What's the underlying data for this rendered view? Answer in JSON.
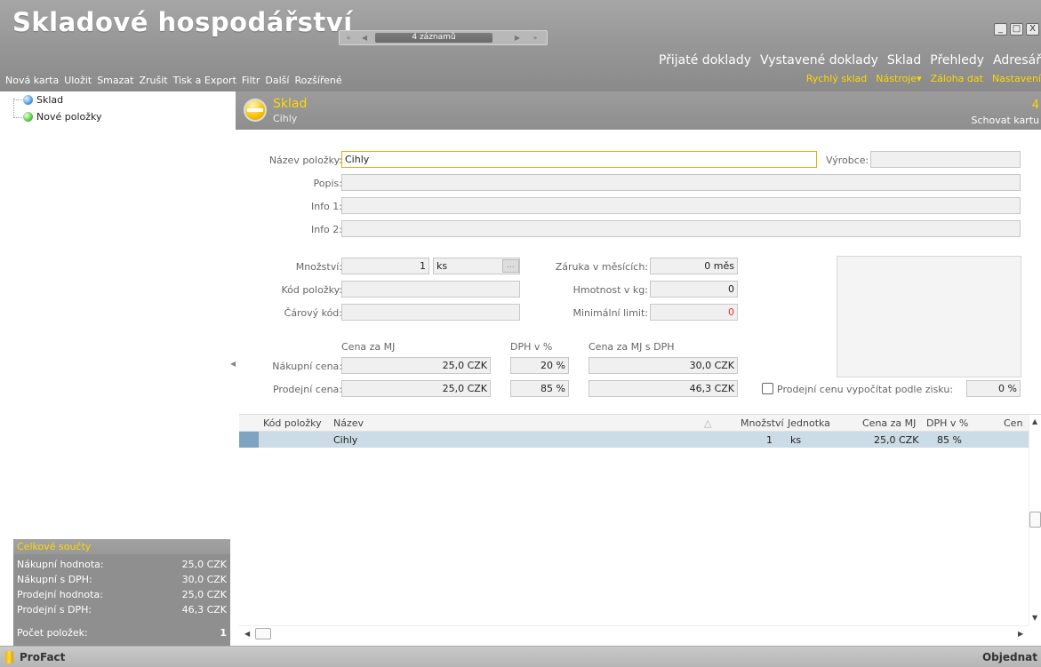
{
  "app": {
    "title": "Skladové hospodářství",
    "brand": "ProFact",
    "order_label": "Objednat"
  },
  "navigator": {
    "first": "«",
    "prev": "◀",
    "records": "4 záznamů",
    "next": "▶",
    "last": "»"
  },
  "window": {
    "minimize": "_",
    "maximize": "□",
    "close": "X"
  },
  "top_nav": [
    "Přijaté doklady",
    "Vystavené doklady",
    "Sklad",
    "Přehledy",
    "Adresář"
  ],
  "sub_nav": [
    "Rychlý sklad",
    "Nástroje▾",
    "Záloha dat",
    "Nastavení"
  ],
  "toolbar": [
    "Nová karta",
    "Uložit",
    "Smazat",
    "Zrušit",
    "Tisk a Export",
    "Filtr",
    "Další",
    "Rozšířené"
  ],
  "tree": [
    {
      "label": "Sklad",
      "icon": "blue-orb-icon"
    },
    {
      "label": "Nové položky",
      "icon": "green-orb-icon"
    }
  ],
  "totals": {
    "heading": "Celkové součty",
    "rows": [
      {
        "label": "Nákupní hodnota:",
        "value": "25,0 CZK"
      },
      {
        "label": "Nákupní s DPH:",
        "value": "30,0 CZK"
      },
      {
        "label": "Prodejní hodnota:",
        "value": "25,0 CZK"
      },
      {
        "label": "Prodejní s DPH:",
        "value": "46,3 CZK"
      },
      {
        "label": "Počet položek:",
        "value": "1"
      }
    ]
  },
  "card": {
    "title": "Sklad",
    "subtitle": "Cihly",
    "count": "4",
    "hide_label": "Schovat kartu"
  },
  "form": {
    "name_label": "Název položky:",
    "name_value": "Cihly",
    "maker_label": "Výrobce:",
    "maker_value": "",
    "desc_label": "Popis:",
    "desc_value": "",
    "info1_label": "Info 1:",
    "info1_value": "",
    "info2_label": "Info 2:",
    "info2_value": "",
    "qty_label": "Množství:",
    "qty_value": "1",
    "unit_value": "ks",
    "dots": "...",
    "code_label": "Kód položky:",
    "code_value": "",
    "barcode_label": "Čárový kód:",
    "barcode_value": "",
    "warranty_label": "Záruka v měsících:",
    "warranty_value": "0 měs",
    "weight_label": "Hmotnost v kg:",
    "weight_value": "0",
    "minlimit_label": "Minimální limit:",
    "minlimit_value": "0",
    "col_price": "Cena za MJ",
    "col_vat": "DPH v %",
    "col_price_vat": "Cena za MJ s DPH",
    "buy_label": "Nákupní cena:",
    "buy_price": "25,0 CZK",
    "buy_vat": "20 %",
    "buy_price_vat": "30,0 CZK",
    "sell_label": "Prodejní cena:",
    "sell_price": "25,0 CZK",
    "sell_vat": "85 %",
    "sell_price_vat": "46,3 CZK",
    "profit_label": "Prodejní cenu vypočítat podle zisku:",
    "profit_value": "0 %"
  },
  "grid": {
    "columns": [
      "Kód položky",
      "Název",
      "Množství",
      "Jednotka",
      "Cena za MJ",
      "DPH v %",
      "Cen"
    ],
    "sort_icon": "△",
    "rows": [
      {
        "code": "",
        "name": "Cihly",
        "qty": "1",
        "unit": "ks",
        "price": "25,0 CZK",
        "vat": "85 %"
      }
    ]
  }
}
